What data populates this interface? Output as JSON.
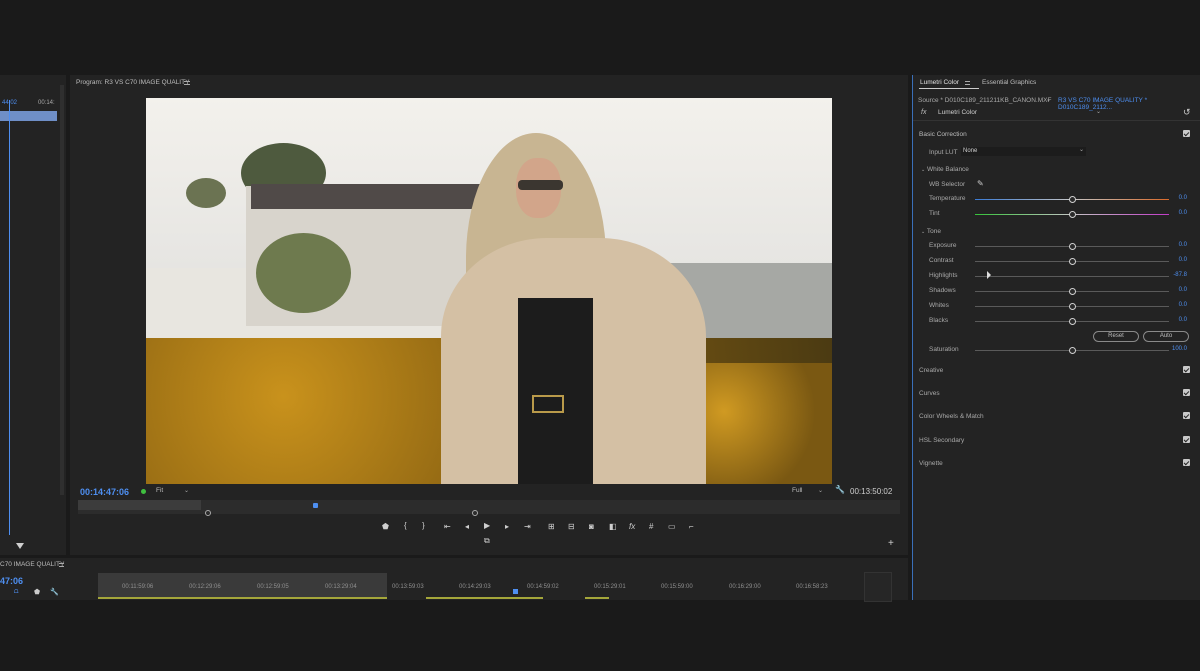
{
  "program": {
    "title": "Program: R3 VS C70 IMAGE QUALITY",
    "timecode_left": "00:14:47:06",
    "fit": "Fit",
    "full": "Full",
    "timecode_right": "00:13:50:02"
  },
  "left_panel": {
    "timecode_a": "44:02",
    "timecode_b": "00:14:"
  },
  "lumetri": {
    "tab_active": "Lumetri Color",
    "tab_other": "Essential Graphics",
    "source": "Source * D010C189_211211KB_CANON.MXF",
    "sequence": "R3 VS C70 IMAGE QUALITY * D010C189_2112...",
    "fx_label": "fx",
    "effect": "Lumetri Color",
    "basic_correction": "Basic Correction",
    "input_lut_label": "Input LUT",
    "input_lut_value": "None",
    "white_balance": "White Balance",
    "wb_selector": "WB Selector",
    "tone": "Tone",
    "sliders": [
      {
        "label": "Temperature",
        "value": "0.0",
        "pos": 0.5
      },
      {
        "label": "Tint",
        "value": "0.0",
        "pos": 0.5
      },
      {
        "label": "Exposure",
        "value": "0.0",
        "pos": 0.5
      },
      {
        "label": "Contrast",
        "value": "0.0",
        "pos": 0.5
      },
      {
        "label": "Highlights",
        "value": "-87.8",
        "pos": 0.06
      },
      {
        "label": "Shadows",
        "value": "0.0",
        "pos": 0.5
      },
      {
        "label": "Whites",
        "value": "0.0",
        "pos": 0.5
      },
      {
        "label": "Blacks",
        "value": "0.0",
        "pos": 0.5
      },
      {
        "label": "Saturation",
        "value": "100.0",
        "pos": 0.5
      }
    ],
    "reset": "Reset",
    "auto": "Auto",
    "sections": [
      "Creative",
      "Curves",
      "Color Wheels & Match",
      "HSL Secondary",
      "Vignette"
    ]
  },
  "timeline": {
    "title": "C70 IMAGE QUALITY",
    "timecode": "47:06",
    "ticks": [
      "00:11:59:06",
      "00:12:29:06",
      "00:12:59:05",
      "00:13:29:04",
      "00:13:59:03",
      "00:14:29:03",
      "00:14:59:02",
      "00:15:29:01",
      "00:15:59:00",
      "00:16:29:00",
      "00:16:58:23"
    ]
  },
  "icons": [
    "hamburger-icon",
    "eyedropper-icon",
    "reset-icon",
    "wrench-icon",
    "play-icon",
    "filter-icon",
    "plus-icon"
  ]
}
